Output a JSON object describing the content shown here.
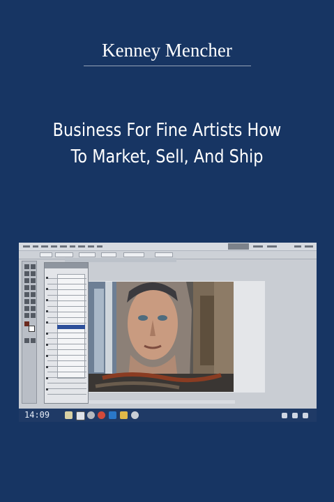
{
  "cover": {
    "author": "Kenney Mencher",
    "title_line1": "Business For Fine Artists How",
    "title_line2": "To Market, Sell, And Ship",
    "background_color": "#173563"
  },
  "screenshot": {
    "clock": "14:09"
  }
}
